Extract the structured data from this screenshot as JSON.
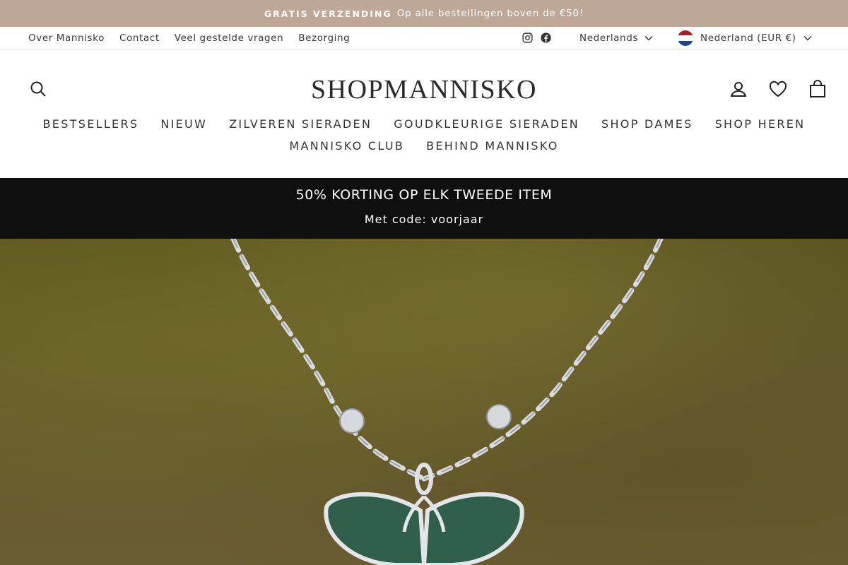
{
  "announcement": {
    "strong": "GRATIS VERZENDING",
    "text": "Op alle bestellingen boven de €50!"
  },
  "utility": {
    "links": [
      "Over Mannisko",
      "Contact",
      "Veel gestelde vragen",
      "Bezorging"
    ],
    "language": "Nederlands",
    "country": "Nederland (EUR €)"
  },
  "header": {
    "logo": "SHOPMANNISKO",
    "nav_row1": [
      "BESTSELLERS",
      "NIEUW",
      "ZILVEREN SIERADEN",
      "GOUDKLEURIGE SIERADEN",
      "SHOP DAMES",
      "SHOP HEREN"
    ],
    "nav_row2": [
      "MANNISKO CLUB",
      "BEHIND MANNISKO"
    ]
  },
  "promo": {
    "title": "50% KORTING OP ELK TWEEDE ITEM",
    "subtitle": "Met code: voorjaar"
  },
  "colors": {
    "announcement_bg": "#bea796",
    "promo_bg": "#0f0f0f"
  },
  "icons": [
    "search-icon",
    "account-icon",
    "wishlist-icon",
    "cart-icon",
    "instagram-icon",
    "facebook-icon",
    "chevron-down-icon",
    "netherlands-flag-icon"
  ]
}
